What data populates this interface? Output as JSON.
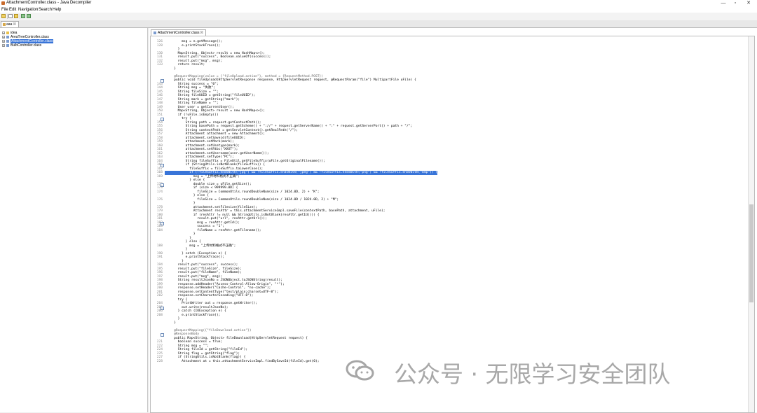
{
  "window": {
    "title": "AttachmentController.class - Java Decompiler",
    "controls": [
      "—",
      "▫",
      "✕"
    ]
  },
  "menu": {
    "items": [
      "File",
      "Edit",
      "Navigation",
      "Search",
      "Help"
    ]
  },
  "outer_tab": {
    "label": "aaa"
  },
  "tree": {
    "items": [
      {
        "label": "idea",
        "type": "folder",
        "selected": false
      },
      {
        "label": "AreaTreeController.class",
        "type": "class",
        "selected": false
      },
      {
        "label": "AttachmentController.class",
        "type": "class",
        "selected": true
      },
      {
        "label": "BulbController.class",
        "type": "class",
        "selected": false
      }
    ]
  },
  "editor_tab": {
    "label": "AttachmentController.class"
  },
  "watermark": {
    "text": "公众号 · 无限学习安全团队"
  },
  "code_lines": [
    {
      "n": "126",
      "t": "        msg = e.getMessage();"
    },
    {
      "n": "128",
      "t": "        e.printStackTrace();"
    },
    {
      "n": "",
      "t": "      }"
    },
    {
      "n": "130",
      "t": "      Map<String, Object> result = new HashMap<>();"
    },
    {
      "n": "131",
      "t": "      result.put(\"success\", Boolean.valueOf(success));"
    },
    {
      "n": "132",
      "t": "      result.put(\"msg\", msg);"
    },
    {
      "n": "133",
      "t": "      return result;"
    },
    {
      "n": "",
      "t": "    }"
    },
    {
      "n": "",
      "t": ""
    },
    {
      "n": "",
      "t": "    @RequestMapping(value = {\"fileUpload.action\"}, method = {RequestMethod.POST})",
      "c": "ann"
    },
    {
      "n": "",
      "t": "    public void fileUpload(HttpServletResponse response, HttpServletRequest request, @RequestParam(\"file\") MultipartFile uFile) {"
    },
    {
      "n": "143",
      "t": "      String success = \"0\";"
    },
    {
      "n": "144",
      "t": "      String msg = \"失败\";"
    },
    {
      "n": "145",
      "t": "      String fileSize = \"\";"
    },
    {
      "n": "146",
      "t": "      String fileUUID = getString(\"fileUUID\");"
    },
    {
      "n": "147",
      "t": "      String mark = getString(\"mark\");"
    },
    {
      "n": "148",
      "t": "      String fileName = \"\";"
    },
    {
      "n": "149",
      "t": "      User user = getCurrentUser();"
    },
    {
      "n": "150",
      "t": "      Map<String, Object> result = new HashMap<>();"
    },
    {
      "n": "151",
      "t": "      if (!uFile.isEmpty())"
    },
    {
      "n": "",
      "t": "        try {"
    },
    {
      "n": "154",
      "t": "          String path = request.getContextPath();"
    },
    {
      "n": "155",
      "t": "          String basePath = request.getScheme() + \"://\" + request.getServerName() + \":\" + request.getServerPort() + path + \"/\";"
    },
    {
      "n": "156",
      "t": "          String contextPath = getServletContext().getRealPath(\"/\");"
    },
    {
      "n": "157",
      "t": "          Attachment attachment = new Attachment();"
    },
    {
      "n": "158",
      "t": "          attachment.setSaveid(fileUUID);"
    },
    {
      "n": "159",
      "t": "          attachment.setMark(mark);"
    },
    {
      "n": "160",
      "t": "          attachment.setUsetype(mark);"
    },
    {
      "n": "161",
      "t": "          attachment.setRtbc(\"XXXT\");"
    },
    {
      "n": "162",
      "t": "          attachment.setUsername(user.getUserName());"
    },
    {
      "n": "163",
      "t": "          attachment.setType(\"PC\");"
    },
    {
      "n": "164",
      "t": "          String fileSuffix = FileUtil.getFileSuffix(uFile.getOriginalFilename());"
    },
    {
      "n": "166",
      "t": "          if (StringUtils.isNotBlank(fileSuffix)) {"
    },
    {
      "n": "167",
      "t": "            fileSuffix = fileSuffix.toLowerCase();"
    },
    {
      "n": "168",
      "t": "            if (!fileSuffix.endsWith(\"jpg\") && !fileSuffix.endsWith(\"jpeg\") && !fileSuffix.endsWith(\"png\") && !fileSuffix.endsWith(\"bmp\")) {",
      "c": "sel"
    },
    {
      "n": "169",
      "t": "              msg = \"上传材料格式不正确\";"
    },
    {
      "n": "",
      "t": "            } else {"
    },
    {
      "n": "172",
      "t": "              double size = uFile.getSize();"
    },
    {
      "n": "173",
      "t": "              if (size < 999999.0D) {"
    },
    {
      "n": "174",
      "t": "                fileSize = CommonUtils.roundDoubleNum(size / 1024.0D, 2) + \"K\";"
    },
    {
      "n": "",
      "t": "              } else {"
    },
    {
      "n": "176",
      "t": "                fileSize = CommonUtils.roundDoubleNum(size / 1024.0D / 1024.0D, 2) + \"M\";"
    },
    {
      "n": "",
      "t": "              }"
    },
    {
      "n": "178",
      "t": "              attachment.setFilesize(fileSize);"
    },
    {
      "n": "179",
      "t": "              Attachment resAttr = this.attachmentServiceImpl.saveFile(contextPath, basePath, attachment, uFile);"
    },
    {
      "n": "180",
      "t": "              if (resAttr != null && StringUtils.isNotBlank(resAttr.getId())) {"
    },
    {
      "n": "181",
      "t": "                result.put(\"url\", resAttr.getUrl());"
    },
    {
      "n": "182",
      "t": "                msg = resAttr.getId();"
    },
    {
      "n": "183",
      "t": "                success = \"1\";"
    },
    {
      "n": "184",
      "t": "                fileName = resAttr.getFilename();"
    },
    {
      "n": "",
      "t": "              }"
    },
    {
      "n": "",
      "t": "            }"
    },
    {
      "n": "",
      "t": "          } else {"
    },
    {
      "n": "188",
      "t": "            msg = \"上传材料格式不正确\";"
    },
    {
      "n": "",
      "t": "          }"
    },
    {
      "n": "190",
      "t": "        } catch (Exception e) {"
    },
    {
      "n": "191",
      "t": "          e.printStackTrace();"
    },
    {
      "n": "",
      "t": "        }"
    },
    {
      "n": "194",
      "t": "      result.put(\"success\", success);"
    },
    {
      "n": "195",
      "t": "      result.put(\"fileSize\", fileSize);"
    },
    {
      "n": "196",
      "t": "      result.put(\"fileName\", fileName);"
    },
    {
      "n": "197",
      "t": "      result.put(\"msg\", msg);"
    },
    {
      "n": "198",
      "t": "      String resultJsonNo = JSONObject.toJSONString(result);"
    },
    {
      "n": "199",
      "t": "      response.addHeader(\"Access-Control-Allow-Origin\", \"*\");"
    },
    {
      "n": "200",
      "t": "      response.setHeader(\"Cache-Control\", \"no-cache\");"
    },
    {
      "n": "201",
      "t": "      response.setContentType(\"text/plain;charset=UTF-8\");"
    },
    {
      "n": "202",
      "t": "      response.setCharacterEncoding(\"UTF-8\");"
    },
    {
      "n": "",
      "t": "      try {"
    },
    {
      "n": "204",
      "t": "        PrintWriter out = response.getWriter();"
    },
    {
      "n": "205",
      "t": "        out.write(resultJsonNo);"
    },
    {
      "n": "206",
      "t": "      } catch (IOException e) {"
    },
    {
      "n": "208",
      "t": "        e.printStackTrace();"
    },
    {
      "n": "",
      "t": "      }"
    },
    {
      "n": "",
      "t": "    }"
    },
    {
      "n": "",
      "t": ""
    },
    {
      "n": "",
      "t": "    @RequestMapping({\"fileDownload.action\"})",
      "c": "ann"
    },
    {
      "n": "",
      "t": "    @ResponseBody",
      "c": "ann"
    },
    {
      "n": "",
      "t": "    public Map<String, Object> fileDownload(HttpServletRequest request) {"
    },
    {
      "n": "221",
      "t": "      boolean success = true;"
    },
    {
      "n": "222",
      "t": "      String msg = \"\";"
    },
    {
      "n": "224",
      "t": "      String fileId = getString(\"fileId\");"
    },
    {
      "n": "225",
      "t": "      String flag = getString(\"flag\");"
    },
    {
      "n": "227",
      "t": "      if (StringUtils.isNotBlank(flag)) {"
    },
    {
      "n": "228",
      "t": "        Attachment at = this.attachmentServiceImpl.findBySaveId(fileId).get(0);"
    }
  ]
}
